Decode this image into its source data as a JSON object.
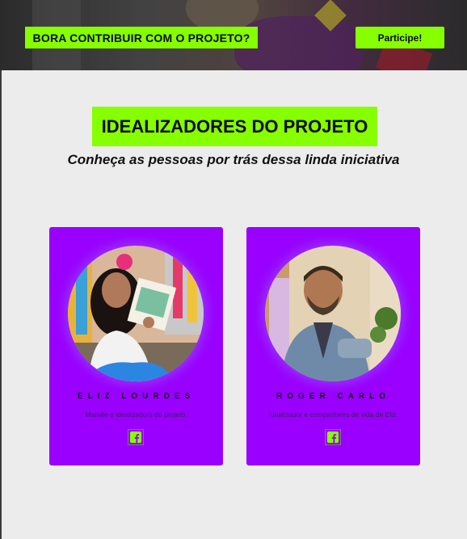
{
  "banner": {
    "cta_text": "BORA CONTRIBUIR COM O PROJETO?",
    "participe_label": "Participe!"
  },
  "section": {
    "title": "IDEALIZADORES DO PROJETO",
    "subtitle": "Conheça as pessoas por trás dessa linda iniciativa"
  },
  "cards": [
    {
      "name": "ELIZ LOURDES",
      "description": "Mamãe e idealizadora do projeto.",
      "icon": "facebook-icon"
    },
    {
      "name": "ROGER CARLO",
      "description": "Idealizador e companheiro de vida de Eliz.",
      "icon": "facebook-icon"
    }
  ],
  "colors": {
    "accent_green": "#86ff00",
    "card_purple": "#9900ff",
    "page_bg": "#ececec"
  }
}
